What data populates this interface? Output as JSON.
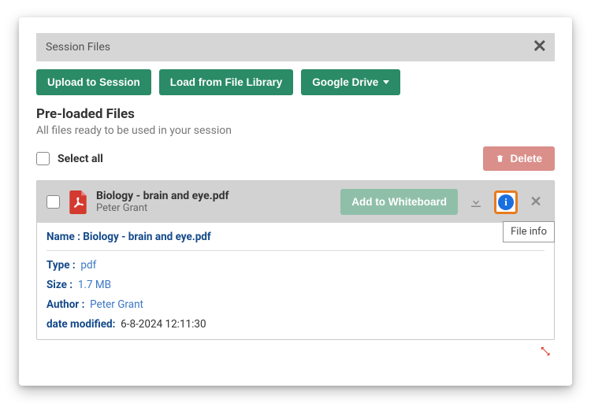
{
  "dialog": {
    "title": "Session Files"
  },
  "toolbar": {
    "upload": "Upload to Session",
    "load_library": "Load from File Library",
    "google_drive": "Google Drive"
  },
  "section": {
    "title": "Pre-loaded Files",
    "subtitle": "All files ready to be used in your session"
  },
  "select_all_label": "Select all",
  "delete_label": "Delete",
  "file": {
    "name": "Biology - brain and eye.pdf",
    "author": "Peter Grant",
    "add_btn": "Add to Whiteboard",
    "tooltip": "File info",
    "details": {
      "name_label": "Name :",
      "name_value": "Biology - brain and eye.pdf",
      "type_label": "Type :",
      "type_value": "pdf",
      "size_label": "Size :",
      "size_value": "1.7 MB",
      "author_label": "Author :",
      "author_value": "Peter Grant",
      "modified_label": "date modified:",
      "modified_value": "6-8-2024 12:11:30"
    }
  }
}
